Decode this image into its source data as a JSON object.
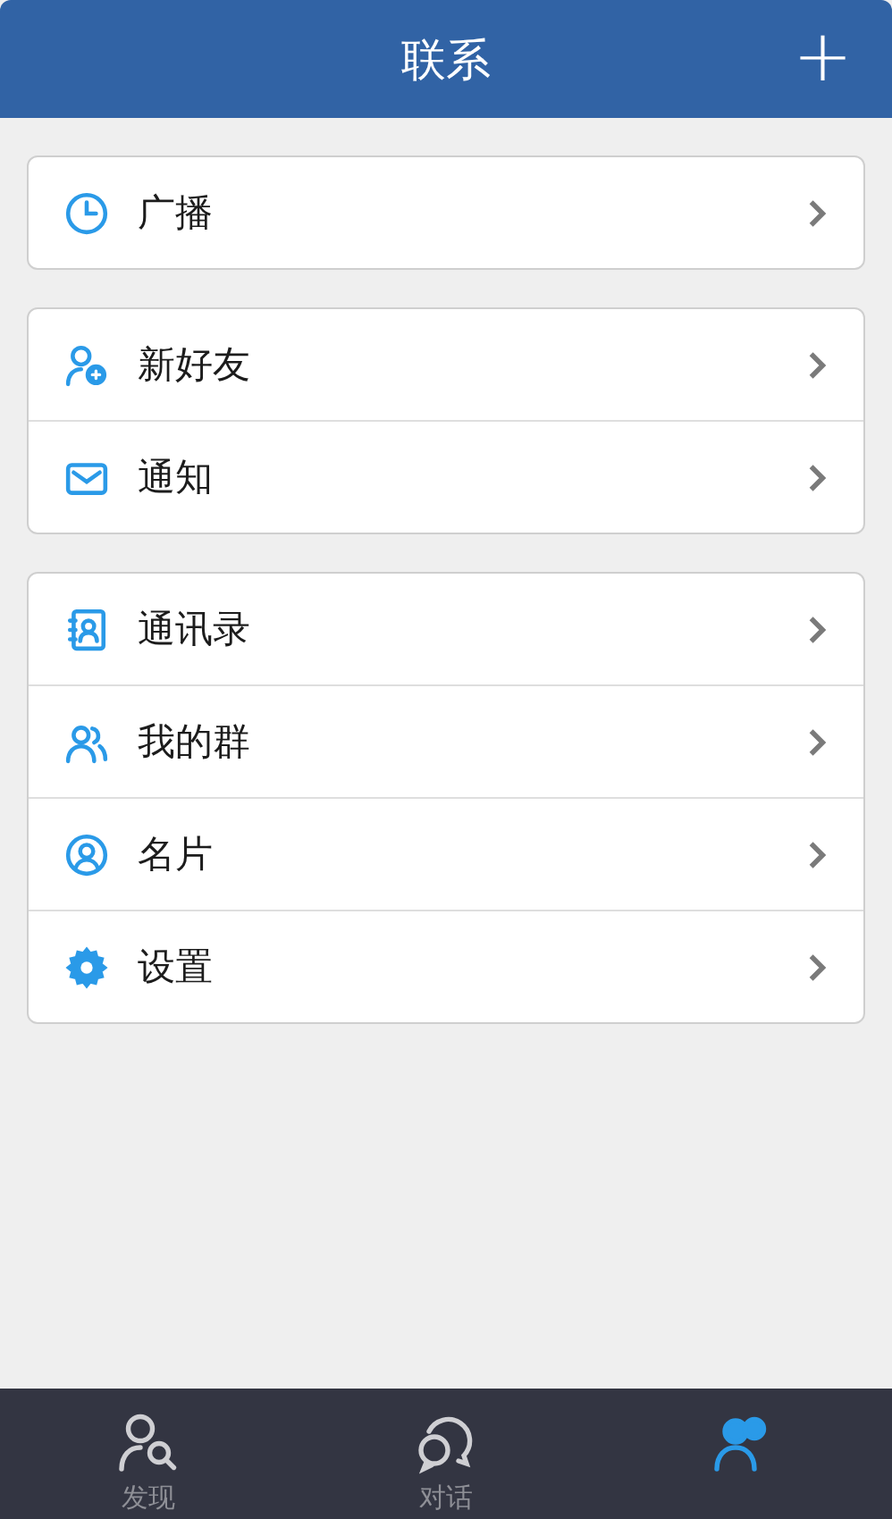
{
  "header": {
    "title": "联系",
    "action": "+"
  },
  "groups": [
    {
      "items": [
        {
          "label": "广播"
        }
      ]
    },
    {
      "items": [
        {
          "label": "新好友"
        },
        {
          "label": "通知"
        }
      ]
    },
    {
      "items": [
        {
          "label": "通讯录"
        },
        {
          "label": "我的群"
        },
        {
          "label": "名片"
        },
        {
          "label": "设置"
        }
      ]
    }
  ],
  "tabs": [
    {
      "label": "发现",
      "selected": false
    },
    {
      "label": "对话",
      "selected": false
    },
    {
      "selected": true
    }
  ]
}
